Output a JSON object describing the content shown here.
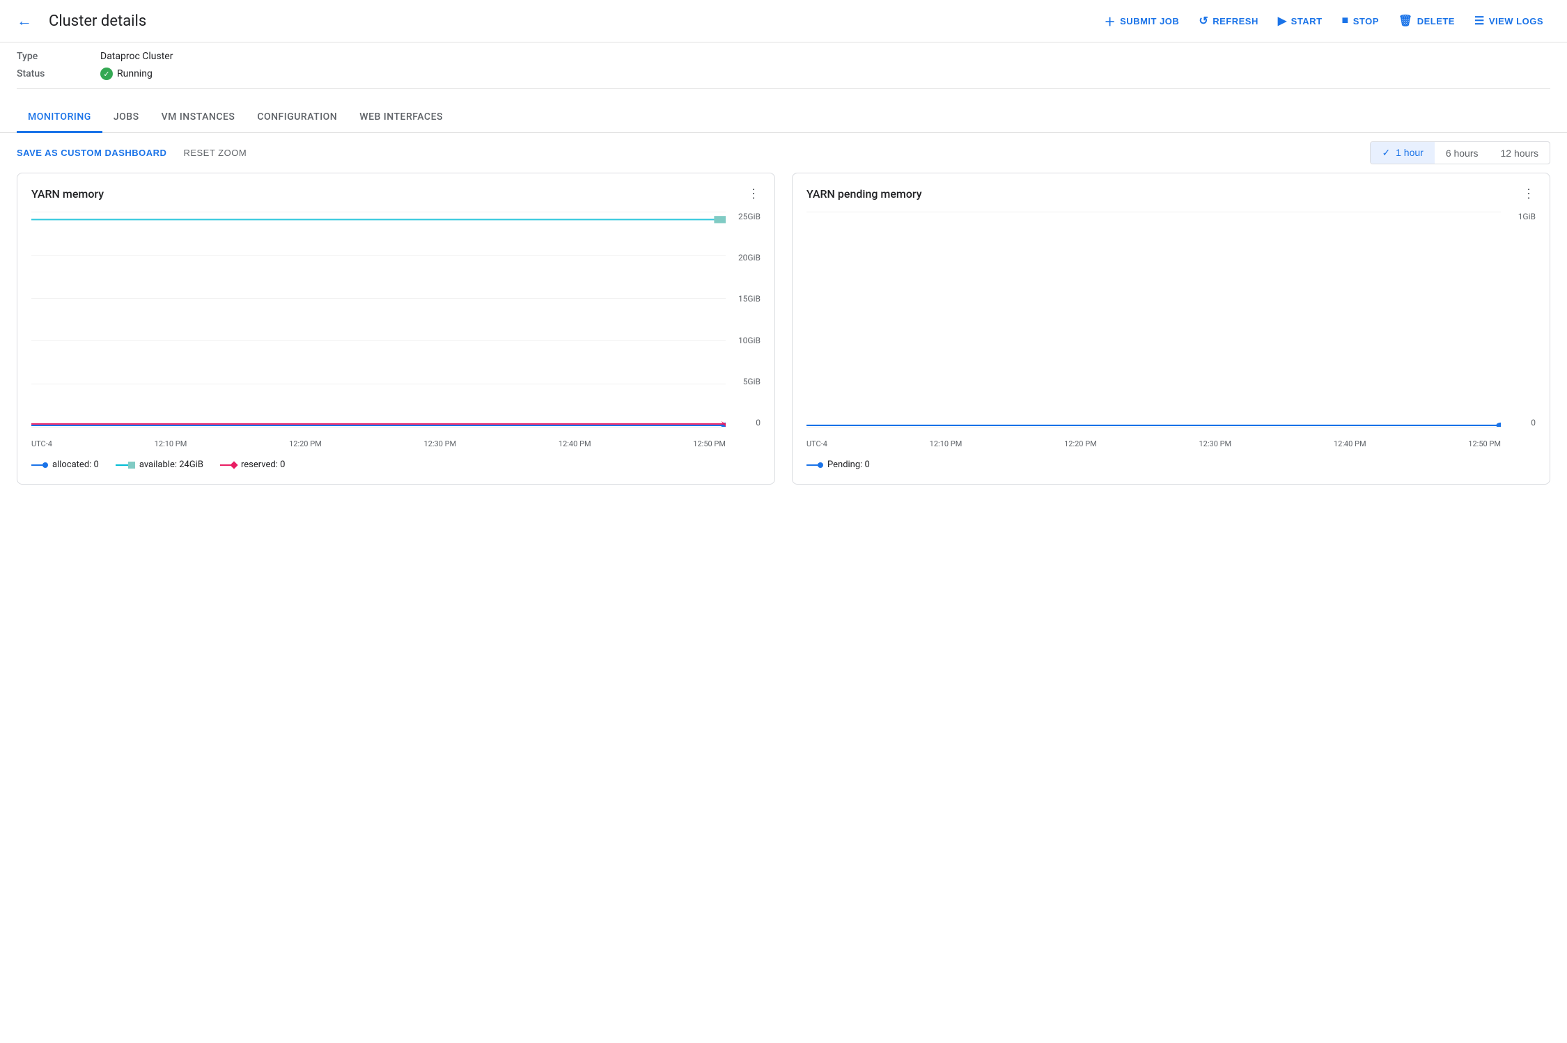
{
  "header": {
    "back_label": "←",
    "title": "Cluster details",
    "buttons": [
      {
        "id": "submit-job",
        "icon": "+",
        "label": "SUBMIT JOB"
      },
      {
        "id": "refresh",
        "icon": "↺",
        "label": "REFRESH"
      },
      {
        "id": "start",
        "icon": "▶",
        "label": "START"
      },
      {
        "id": "stop",
        "icon": "■",
        "label": "STOP"
      },
      {
        "id": "delete",
        "icon": "🗑",
        "label": "DELETE"
      },
      {
        "id": "view-logs",
        "icon": "≡",
        "label": "VIEW LOGS"
      }
    ]
  },
  "meta": {
    "type_label": "Type",
    "type_value": "Dataproc Cluster",
    "status_label": "Status",
    "status_value": "Running"
  },
  "tabs": [
    {
      "id": "monitoring",
      "label": "MONITORING",
      "active": true
    },
    {
      "id": "jobs",
      "label": "JOBS",
      "active": false
    },
    {
      "id": "vm-instances",
      "label": "VM INSTANCES",
      "active": false
    },
    {
      "id": "configuration",
      "label": "CONFIGURATION",
      "active": false
    },
    {
      "id": "web-interfaces",
      "label": "WEB INTERFACES",
      "active": false
    }
  ],
  "toolbar": {
    "save_dashboard": "SAVE AS CUSTOM DASHBOARD",
    "reset_zoom": "RESET ZOOM",
    "time_options": [
      {
        "id": "1hour",
        "label": "1 hour",
        "active": true
      },
      {
        "id": "6hours",
        "label": "6 hours",
        "active": false
      },
      {
        "id": "12hours",
        "label": "12 hours",
        "active": false
      }
    ]
  },
  "charts": [
    {
      "id": "yarn-memory",
      "title": "YARN memory",
      "y_labels": [
        "25GiB",
        "20GiB",
        "15GiB",
        "10GiB",
        "5GiB",
        "0"
      ],
      "x_labels": [
        "UTC-4",
        "12:10 PM",
        "12:20 PM",
        "12:30 PM",
        "12:40 PM",
        "12:50 PM"
      ],
      "legend": [
        {
          "id": "allocated",
          "type": "line-circle",
          "color": "#1a73e8",
          "label": "allocated: 0"
        },
        {
          "id": "available",
          "type": "line-square",
          "color": "#00bcd4",
          "fill": "#80cbc4",
          "label": "available: 24GiB"
        },
        {
          "id": "reserved",
          "type": "line-diamond",
          "color": "#e91e63",
          "label": "reserved: 0"
        }
      ]
    },
    {
      "id": "yarn-pending-memory",
      "title": "YARN pending memory",
      "y_labels": [
        "1GiB",
        "0"
      ],
      "x_labels": [
        "UTC-4",
        "12:10 PM",
        "12:20 PM",
        "12:30 PM",
        "12:40 PM",
        "12:50 PM"
      ],
      "legend": [
        {
          "id": "pending",
          "type": "line-circle",
          "color": "#1a73e8",
          "label": "Pending: 0"
        }
      ]
    }
  ]
}
